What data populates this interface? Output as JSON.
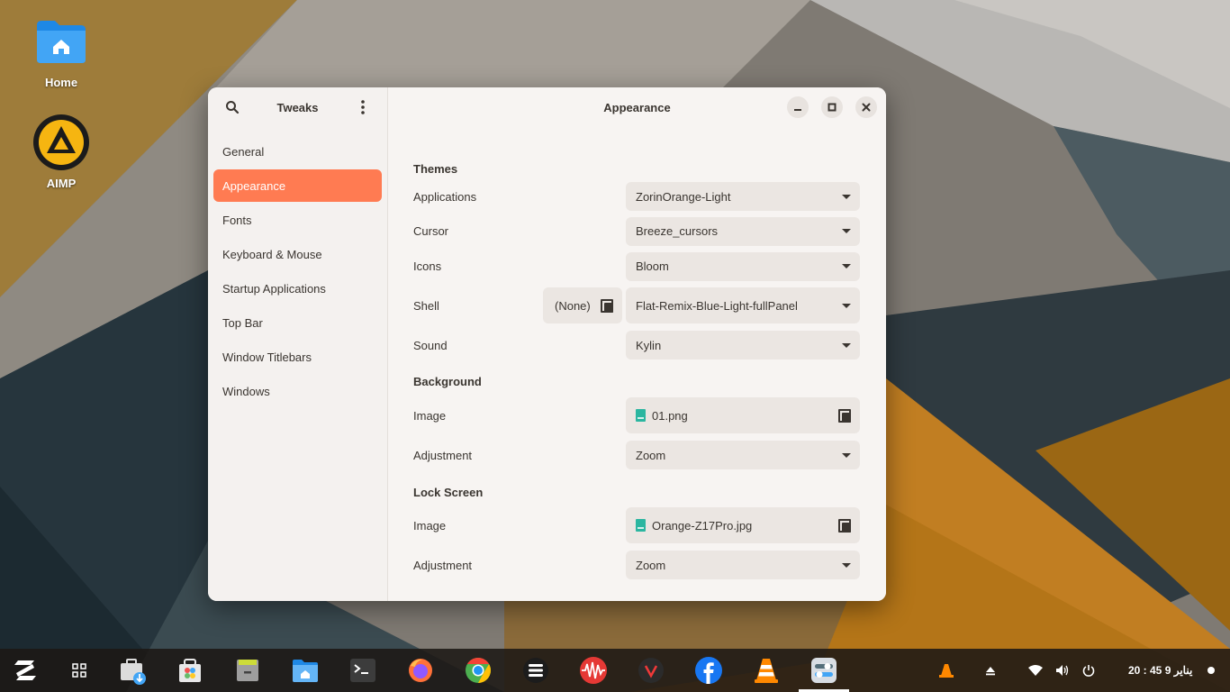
{
  "desktop": {
    "icons": [
      {
        "label": "Home",
        "icon": "home-folder-icon"
      },
      {
        "label": "AIMP",
        "icon": "aimp-icon"
      }
    ]
  },
  "window": {
    "sidebar": {
      "title": "Tweaks",
      "items": [
        {
          "label": "General"
        },
        {
          "label": "Appearance",
          "active": true
        },
        {
          "label": "Fonts"
        },
        {
          "label": "Keyboard & Mouse"
        },
        {
          "label": "Startup Applications"
        },
        {
          "label": "Top Bar"
        },
        {
          "label": "Window Titlebars"
        },
        {
          "label": "Windows"
        }
      ]
    },
    "main": {
      "title": "Appearance",
      "themes": {
        "heading": "Themes",
        "applications": {
          "label": "Applications",
          "value": "ZorinOrange-Light"
        },
        "cursor": {
          "label": "Cursor",
          "value": "Breeze_cursors"
        },
        "icons": {
          "label": "Icons",
          "value": "Bloom"
        },
        "shell": {
          "label": "Shell",
          "none_label": "(None)",
          "value": "Flat-Remix-Blue-Light-fullPanel"
        },
        "sound": {
          "label": "Sound",
          "value": "Kylin"
        }
      },
      "background": {
        "heading": "Background",
        "image": {
          "label": "Image",
          "value": "01.png"
        },
        "adjustment": {
          "label": "Adjustment",
          "value": "Zoom"
        }
      },
      "lock_screen": {
        "heading": "Lock Screen",
        "image": {
          "label": "Image",
          "value": "Orange-Z17Pro.jpg"
        },
        "adjustment": {
          "label": "Adjustment",
          "value": "Zoom"
        }
      }
    }
  },
  "taskbar": {
    "apps": [
      "zorin-menu-icon",
      "app-grid-icon",
      "software-updater-icon",
      "software-store-icon",
      "archive-manager-icon",
      "files-icon",
      "terminal-icon",
      "firefox-icon",
      "chrome-icon",
      "task-list-icon",
      "audio-waveform-icon",
      "vivaldi-icon",
      "facebook-icon",
      "vlc-icon",
      "tweaks-icon"
    ],
    "clock": "20 : 45 يناير 9"
  },
  "colors": {
    "accent": "#ff7b52",
    "window_bg": "#f7f4f2",
    "combo_bg": "#ebe6e2"
  }
}
